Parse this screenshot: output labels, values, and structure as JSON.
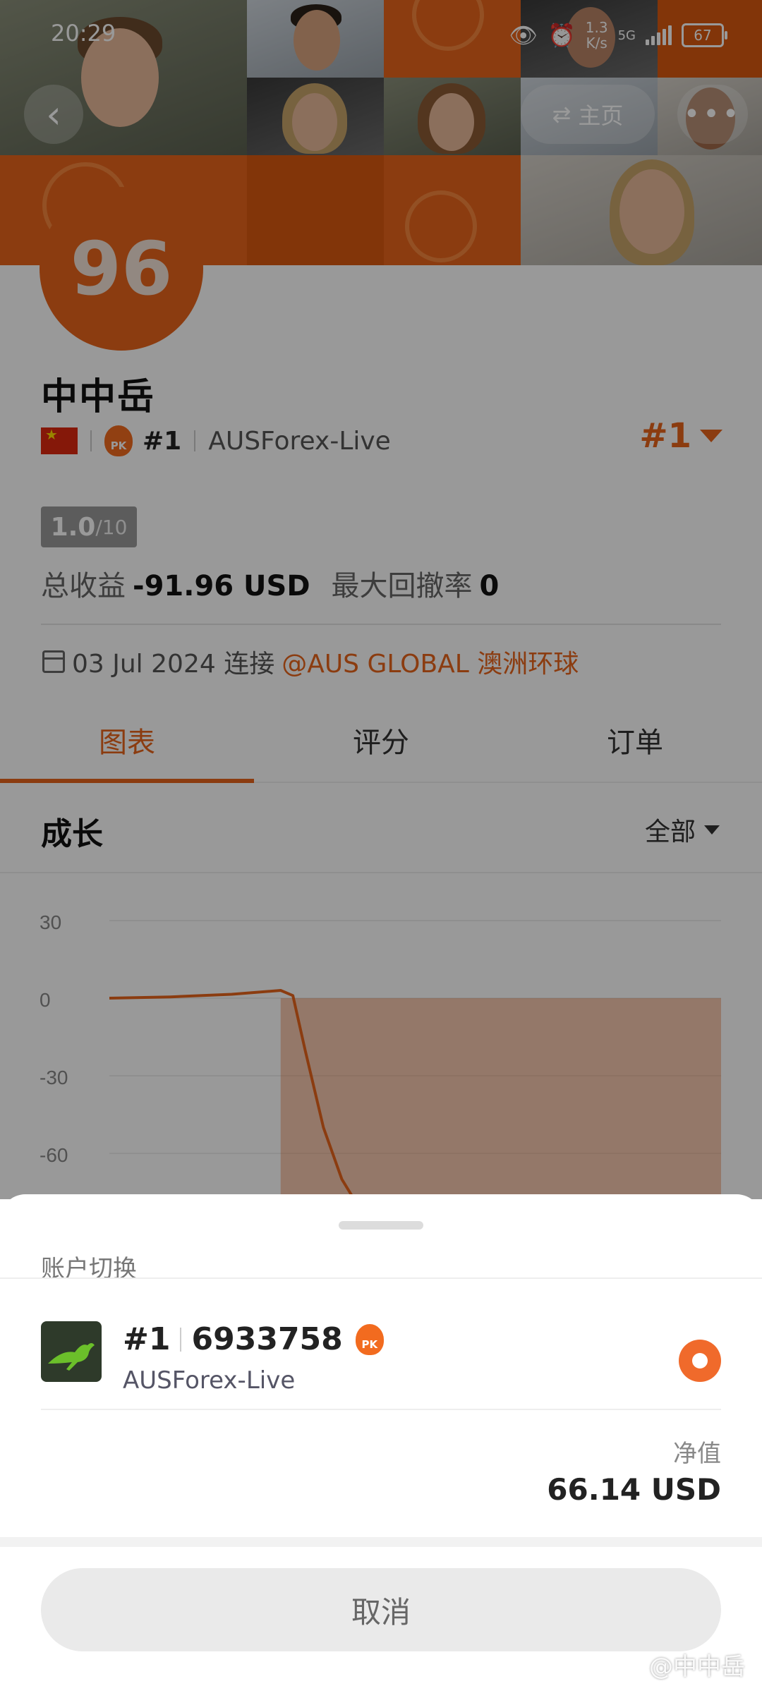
{
  "status_bar": {
    "time": "20:29",
    "speed_value": "1.3",
    "speed_unit": "K/s",
    "network": "5G",
    "battery": "67"
  },
  "header": {
    "home_label": "主页",
    "more_label": "•••"
  },
  "profile": {
    "score": "96",
    "username": "中中岳",
    "rank": "#1",
    "server": "AUSForex-Live",
    "rank_right": "#1",
    "rating_value": "1.0",
    "rating_max": "/10",
    "total_profit_label": "总收益",
    "total_profit_value": "-91.96 USD",
    "max_drawdown_label": "最大回撤率",
    "max_drawdown_value": "0",
    "connect_date": "03 Jul 2024 连接",
    "broker": "@AUS GLOBAL 澳洲环球"
  },
  "tabs": [
    {
      "label": "图表",
      "active": true
    },
    {
      "label": "评分",
      "active": false
    },
    {
      "label": "订单",
      "active": false
    }
  ],
  "growth": {
    "title": "成长",
    "filter": "全部"
  },
  "chart_data": {
    "type": "area",
    "y_ticks": [
      "30",
      "0",
      "-30",
      "-60"
    ],
    "ylim": [
      -75,
      35
    ],
    "x": [
      0,
      0.1,
      0.2,
      0.28,
      0.3,
      0.32,
      0.35,
      0.38,
      0.4
    ],
    "values": [
      0,
      0.5,
      1.5,
      3,
      1,
      -20,
      -50,
      -70,
      -80
    ],
    "fill_color": "#e8651c",
    "line_color": "#e8651c"
  },
  "sheet": {
    "title": "账户切换",
    "account_rank": "#1",
    "account_number": "6933758",
    "account_server": "AUSForex-Live",
    "pk_label": "PK",
    "net_label": "净值",
    "net_value": "66.14 USD",
    "cancel_label": "取消",
    "watermark": "@中中岳"
  }
}
